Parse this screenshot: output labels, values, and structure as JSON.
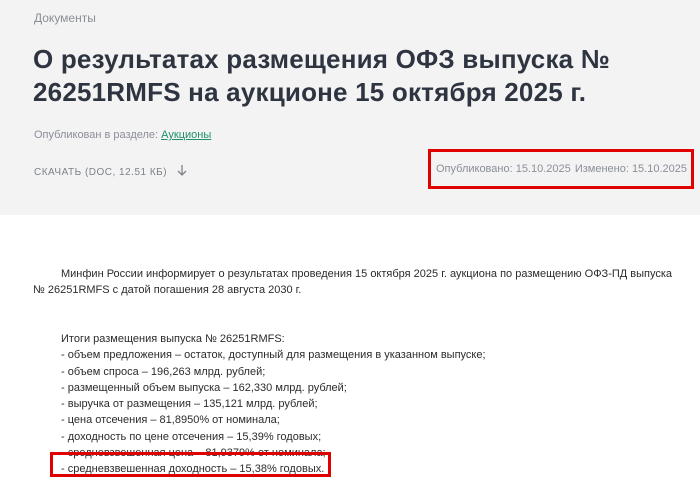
{
  "breadcrumb": "Документы",
  "title": "О результатах размещения ОФЗ выпуска № 26251RMFS на аукционе 15 октября 2025 г.",
  "section": {
    "prefix": "Опубликован в разделе:",
    "link": "Аукционы"
  },
  "download": {
    "label": "СКАЧАТЬ (DOC, 12.51 КБ)",
    "icon": "arrow-down-icon"
  },
  "dates": {
    "published": "Опубликовано: 15.10.2025",
    "modified": "Изменено: 15.10.2025"
  },
  "intro": "Минфин России информирует о результатах проведения 15 октября 2025 г. аукциона по размещению ОФЗ-ПД выпуска № 26251RMFS с датой погашения 28 августа 2030 г.",
  "results": [
    "Итоги размещения выпуска № 26251RMFS:",
    "- объем предложения – остаток, доступный для размещения в указанном выпуске;",
    "- объем спроса – 196,263 млрд. рублей;",
    "- размещенный объем выпуска – 162,330 млрд. рублей;",
    "- выручка от размещения – 135,121 млрд. рублей;",
    "- цена отсечения – 81,8950% от номинала;",
    "- доходность по цене отсечения – 15,39% годовых;",
    "- средневзвешенная цена – 81,9379% от номинала;",
    "- средневзвешенная доходность – 15,38% годовых."
  ],
  "colors": {
    "highlight": "#e10000",
    "link": "#1f8f6a",
    "header_bg": "#f3f3f4"
  }
}
